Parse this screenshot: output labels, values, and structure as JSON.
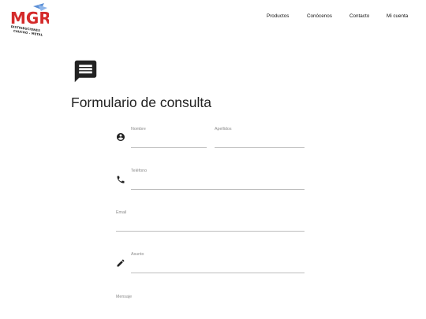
{
  "brand": {
    "logo_letters": "MGR",
    "logo_line1": "DISTRIBUCIONES",
    "logo_line2": "CAUCHO - METAL",
    "colors": {
      "red": "#d42a2a",
      "blue": "#5b8fd6"
    }
  },
  "nav": {
    "items": [
      "Productos",
      "Conócenos",
      "Contacto",
      "Mi cuenta"
    ]
  },
  "page": {
    "title_icon": "message-icon",
    "title": "Formulario de consulta"
  },
  "form": {
    "nombre": {
      "label": "Nombre",
      "value": "",
      "icon": "account-circle-icon"
    },
    "apellidos": {
      "label": "Apellidos",
      "value": ""
    },
    "telefono": {
      "label": "Teléfono",
      "value": "",
      "icon": "phone-icon"
    },
    "email": {
      "label": "Email",
      "value": ""
    },
    "asunto": {
      "label": "Asunto",
      "value": "",
      "icon": "pencil-icon"
    },
    "mensaje": {
      "label": "Mensaje",
      "value": ""
    }
  }
}
